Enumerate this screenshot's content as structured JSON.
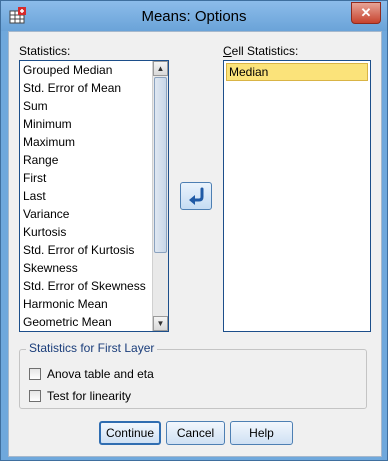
{
  "window": {
    "title": "Means: Options"
  },
  "statistics": {
    "label": "Statistics:",
    "items": [
      "Grouped Median",
      "Std. Error of Mean",
      "Sum",
      "Minimum",
      "Maximum",
      "Range",
      "First",
      "Last",
      "Variance",
      "Kurtosis",
      "Std. Error of Kurtosis",
      "Skewness",
      "Std. Error of Skewness",
      "Harmonic Mean",
      "Geometric Mean"
    ]
  },
  "cell_statistics": {
    "label": "Cell Statistics:",
    "items": [
      "Median"
    ],
    "selected": "Median"
  },
  "first_layer": {
    "title": "Statistics for First Layer",
    "anova_label": "Anova table and eta",
    "anova_checked": false,
    "linearity_label": "Test for linearity",
    "linearity_checked": false
  },
  "buttons": {
    "continue": "Continue",
    "cancel": "Cancel",
    "help": "Help"
  },
  "icons": {
    "app": "spss-table-icon",
    "close": "close-icon",
    "move": "move-left-arrow-icon"
  },
  "colors": {
    "titlebar": "#6fa8dc",
    "selection": "#fbe37a",
    "close": "#c7432e"
  }
}
